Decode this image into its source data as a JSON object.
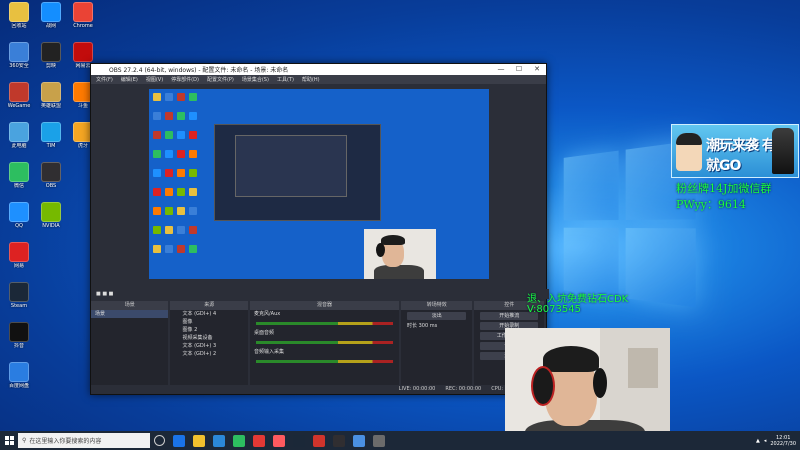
{
  "desktop": {
    "icons": [
      {
        "label": "回收站",
        "color": "#e8c040"
      },
      {
        "label": "360安全",
        "color": "#3a7fd8"
      },
      {
        "label": "WeGame",
        "color": "#c0392b"
      },
      {
        "label": "此电脑",
        "color": "#4aa3df"
      },
      {
        "label": "微信",
        "color": "#2dbe60"
      },
      {
        "label": "QQ",
        "color": "#1e90ff"
      },
      {
        "label": "网易",
        "color": "#d22"
      },
      {
        "label": "Steam",
        "color": "#1b2838"
      },
      {
        "label": "抖音",
        "color": "#111"
      },
      {
        "label": "百度网盘",
        "color": "#2a7de1"
      },
      {
        "label": "战网",
        "color": "#148eff"
      },
      {
        "label": "剪映",
        "color": "#222"
      },
      {
        "label": "英雄联盟",
        "color": "#c8a14a"
      },
      {
        "label": "TIM",
        "color": "#1aa1e8"
      },
      {
        "label": "OBS",
        "color": "#302e31"
      },
      {
        "label": "NVIDIA",
        "color": "#76b900"
      },
      {
        "label": "Chrome",
        "color": "#ea4335"
      },
      {
        "label": "网易云",
        "color": "#c20c0c"
      },
      {
        "label": "斗鱼",
        "color": "#ff7a00"
      },
      {
        "label": "虎牙",
        "color": "#f5a623"
      }
    ]
  },
  "obs": {
    "title": "OBS 27.2.4 (64-bit, windows) - 配置文件: 未命名 - 场景: 未命名",
    "menu": [
      "文件(F)",
      "编辑(E)",
      "视图(V)",
      "停靠部件(D)",
      "配置文件(P)",
      "场景集合(S)",
      "工具(T)",
      "帮助(H)"
    ],
    "dock_titles": {
      "scenes": "场景",
      "sources": "来源",
      "mixer": "混音器",
      "transitions": "转场特效",
      "controls": "控件"
    },
    "scenes": [
      "场景"
    ],
    "sources": [
      "文本 (GDI+) 4",
      "图像",
      "图像 2",
      "视频采集设备",
      "文本 (GDI+) 3",
      "文本 (GDI+) 2"
    ],
    "mixer": [
      "麦克风/Aux",
      "桌面音频",
      "音频输入采集"
    ],
    "transition": {
      "type": "淡出",
      "duration_label": "时长",
      "duration": "300 ms"
    },
    "controls": [
      "开始推流",
      "开始录制",
      "工作室模式",
      "设置",
      "退出"
    ],
    "status": {
      "live": "LIVE: 00:00:00",
      "rec": "REC: 00:00:00",
      "cpu": "CPU: 1.9%, 60.00 fps"
    }
  },
  "overlay": {
    "fan_banner": "潮玩来袭 有你就GO",
    "fan_line": "粉丝牌14J加微信群",
    "pw_line": "PWyy：9614",
    "exit_line": "退、入坑免费钻石CDK",
    "v_line": "V:8073545"
  },
  "taskbar": {
    "search_placeholder": "在这里输入你要搜索的内容",
    "time": "12:01",
    "date": "2022/7/30"
  }
}
